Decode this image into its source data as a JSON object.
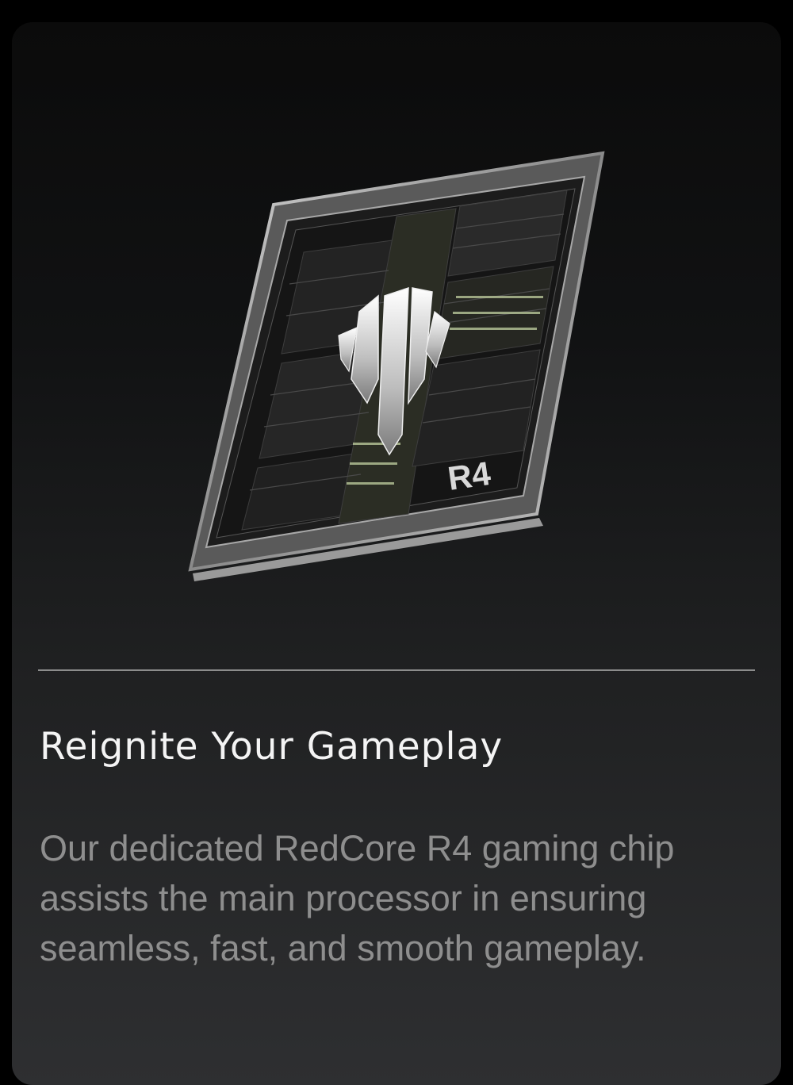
{
  "chip": {
    "badge_text": "R4",
    "logo_icon": "red-magic-logo-icon"
  },
  "feature": {
    "title": "Reignite Your Gameplay",
    "description_lines": [
      "Our dedicated RedCore R4 gaming chip",
      "assists the main processor in ensuring",
      "seamless, fast, and smooth gameplay."
    ]
  },
  "colors": {
    "card_top": "#0b0b0b",
    "card_bottom": "#2e2f31",
    "title": "#f4f4f4",
    "description": "#8e8e8e",
    "divider": "#8c8c8c"
  }
}
